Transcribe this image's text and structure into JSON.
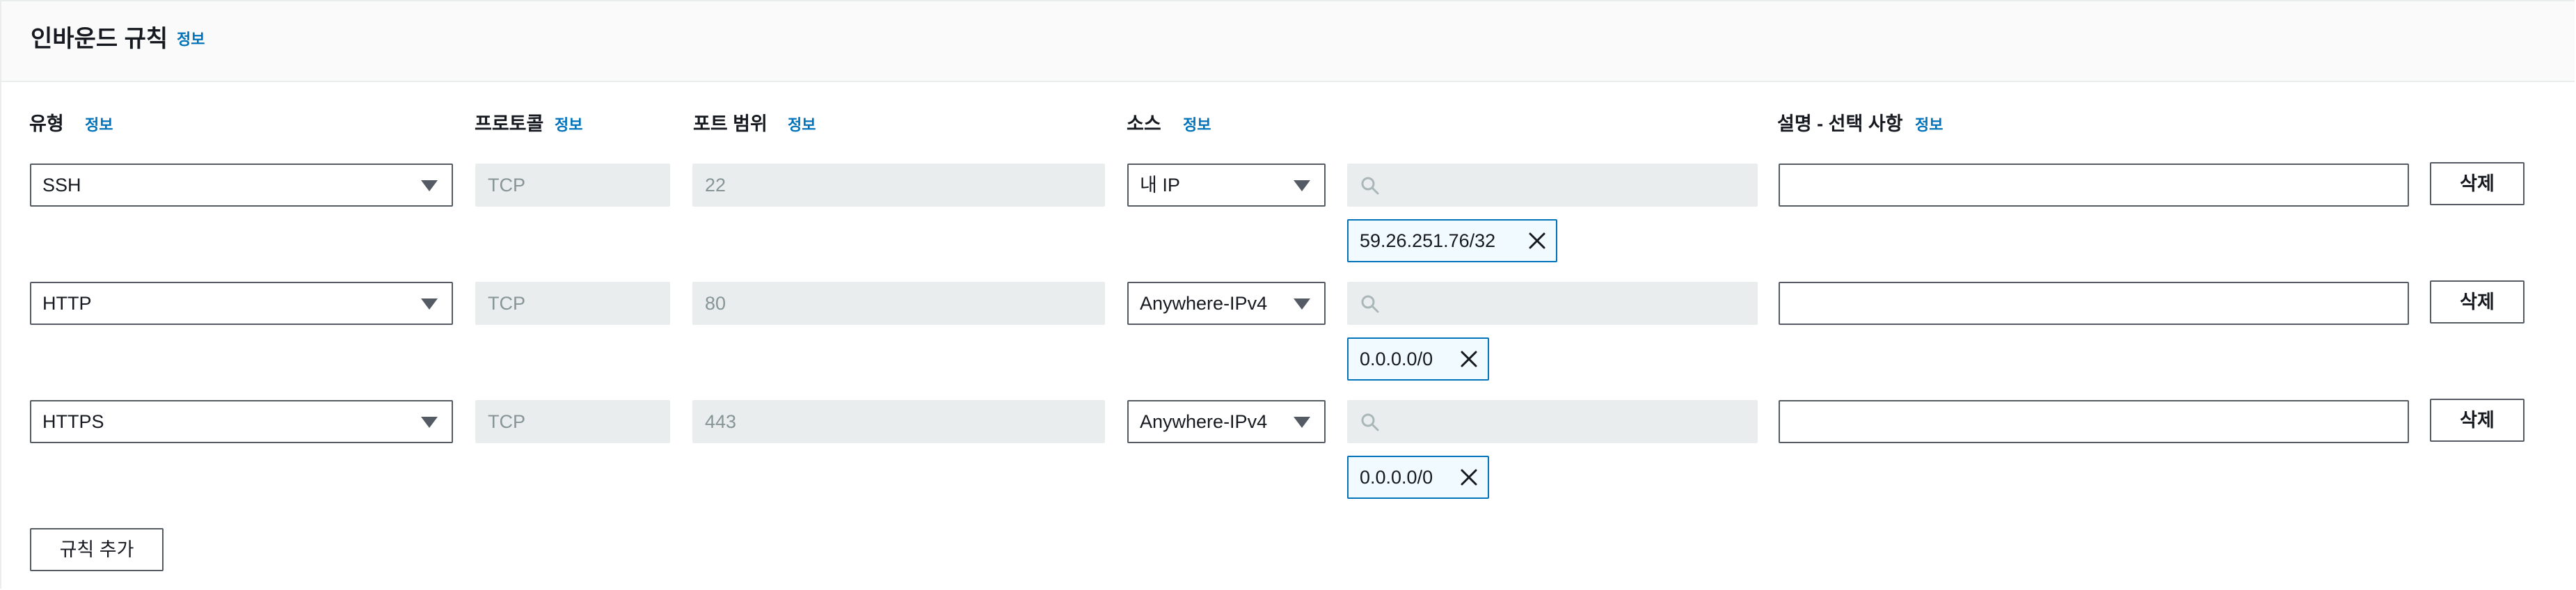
{
  "section": {
    "title": "인바운드 규칙",
    "info": "정보"
  },
  "columns": {
    "type": {
      "label": "유형",
      "info": "정보"
    },
    "protocol": {
      "label": "프로토콜",
      "info": "정보"
    },
    "port_range": {
      "label": "포트 범위",
      "info": "정보"
    },
    "source": {
      "label": "소스",
      "info": "정보"
    },
    "description": {
      "label": "설명 - 선택 사항",
      "info": "정보"
    }
  },
  "rules": [
    {
      "type": "SSH",
      "protocol": "TCP",
      "port": "22",
      "source": "내 IP",
      "search_value": "",
      "cidr": "59.26.251.76/32",
      "description": "",
      "delete_label": "삭제"
    },
    {
      "type": "HTTP",
      "protocol": "TCP",
      "port": "80",
      "source": "Anywhere-IPv4",
      "search_value": "",
      "cidr": "0.0.0.0/0",
      "description": "",
      "delete_label": "삭제"
    },
    {
      "type": "HTTPS",
      "protocol": "TCP",
      "port": "443",
      "source": "Anywhere-IPv4",
      "search_value": "",
      "cidr": "0.0.0.0/0",
      "description": "",
      "delete_label": "삭제"
    }
  ],
  "add_rule_label": "규칙 추가",
  "icons": {
    "dropdown": "caret-down-icon",
    "search": "search-icon",
    "remove": "close-icon"
  },
  "colors": {
    "link": "#0073bb",
    "border": "#545b64",
    "disabled_bg": "#eaeded",
    "token_bg": "#f1faff"
  }
}
